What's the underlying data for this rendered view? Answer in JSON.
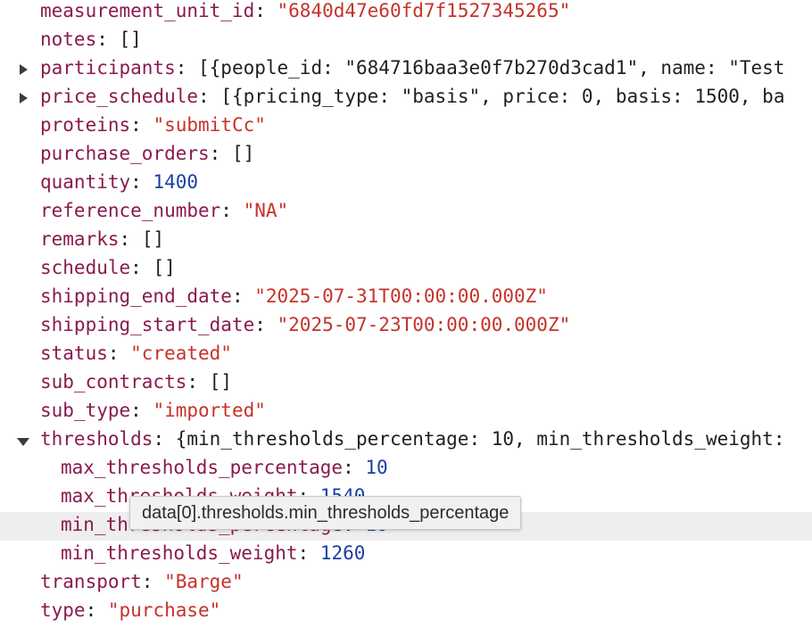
{
  "rows": {
    "measurement_unit_id": {
      "key": "measurement_unit_id",
      "value": "\"6840d47e60fd7f1527345265\""
    },
    "notes": {
      "key": "notes",
      "value": "[]"
    },
    "participants": {
      "key": "participants",
      "value": "[{people_id: \"684716baa3e0f7b270d3cad1\", name: \"Test"
    },
    "price_schedule": {
      "key": "price_schedule",
      "value": "[{pricing_type: \"basis\", price: 0, basis: 1500, ba"
    },
    "proteins": {
      "key": "proteins",
      "value": "\"submitCc\""
    },
    "purchase_orders": {
      "key": "purchase_orders",
      "value": "[]"
    },
    "quantity": {
      "key": "quantity",
      "value": "1400"
    },
    "reference_number": {
      "key": "reference_number",
      "value": "\"NA\""
    },
    "remarks": {
      "key": "remarks",
      "value": "[]"
    },
    "schedule": {
      "key": "schedule",
      "value": "[]"
    },
    "shipping_end_date": {
      "key": "shipping_end_date",
      "value": "\"2025-07-31T00:00:00.000Z\""
    },
    "shipping_start_date": {
      "key": "shipping_start_date",
      "value": "\"2025-07-23T00:00:00.000Z\""
    },
    "status": {
      "key": "status",
      "value": "\"created\""
    },
    "sub_contracts": {
      "key": "sub_contracts",
      "value": "[]"
    },
    "sub_type": {
      "key": "sub_type",
      "value": "\"imported\""
    },
    "thresholds": {
      "key": "thresholds",
      "value": "{min_thresholds_percentage: 10, min_thresholds_weight:"
    },
    "max_thresholds_percentage": {
      "key": "max_thresholds_percentage",
      "value": "10"
    },
    "max_thresholds_weight": {
      "key": "max_thresholds_weight",
      "value": "1540"
    },
    "min_thresholds_percentage": {
      "key": "min_thresholds_percentage",
      "value": "10"
    },
    "min_thresholds_weight": {
      "key": "min_thresholds_weight",
      "value": "1260"
    },
    "transport": {
      "key": "transport",
      "value": "\"Barge\""
    },
    "type": {
      "key": "type",
      "value": "\"purchase\""
    }
  },
  "tooltip": {
    "text": "data[0].thresholds.min_thresholds_percentage"
  },
  "colors": {
    "key": "#8a1a4e",
    "string": "#c5332a",
    "number": "#1a3ea3",
    "hover_row": "#eeeeee"
  },
  "icons": {
    "collapsed": "triangle-right-icon",
    "expanded": "triangle-down-icon"
  }
}
